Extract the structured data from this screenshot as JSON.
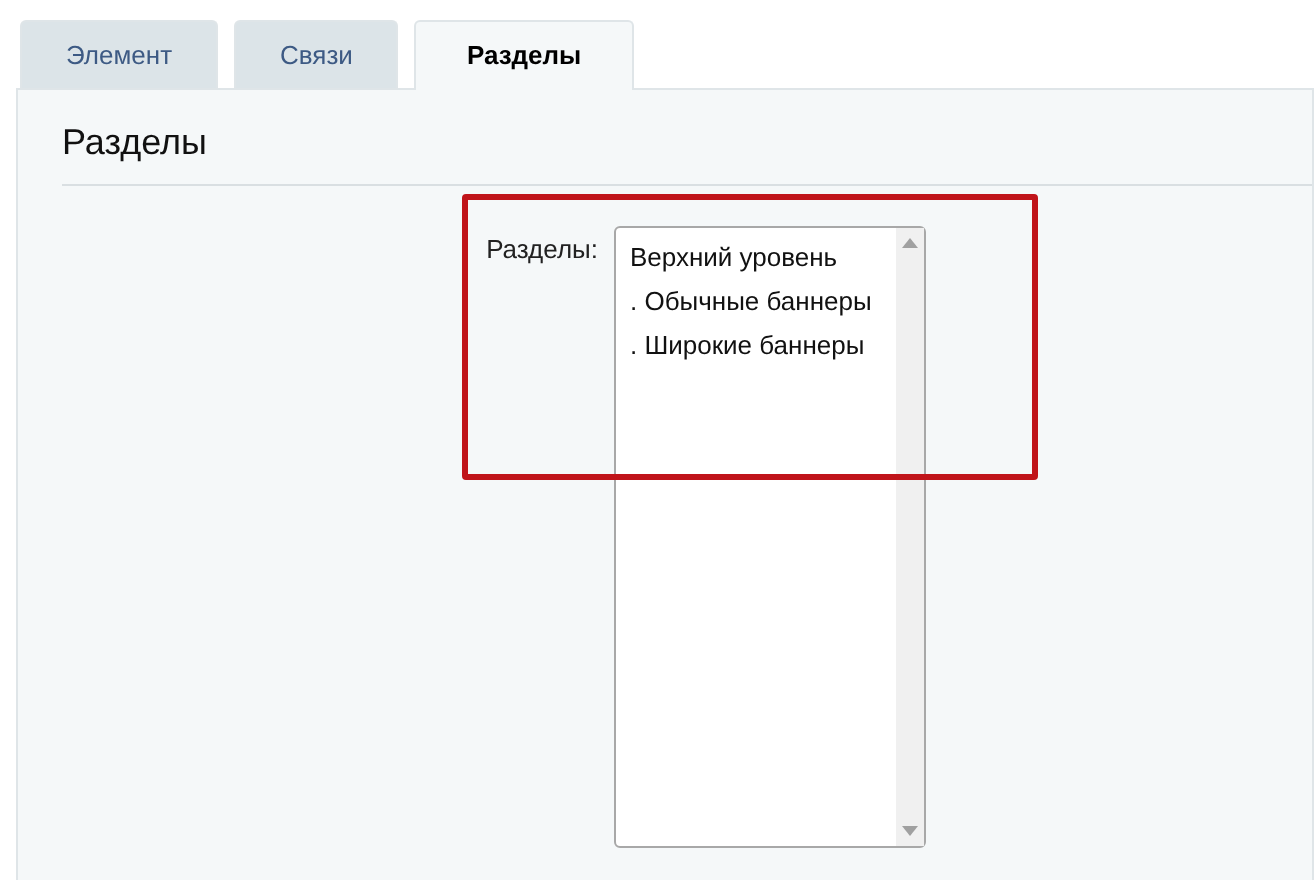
{
  "tabs": [
    {
      "label": "Элемент",
      "selected": false
    },
    {
      "label": "Связи",
      "selected": false
    },
    {
      "label": "Разделы",
      "selected": true
    }
  ],
  "section_title": "Разделы",
  "field": {
    "label": "Разделы:",
    "options": [
      "Верхний уровень",
      ". Обычные баннеры",
      ". Широкие баннеры"
    ]
  }
}
